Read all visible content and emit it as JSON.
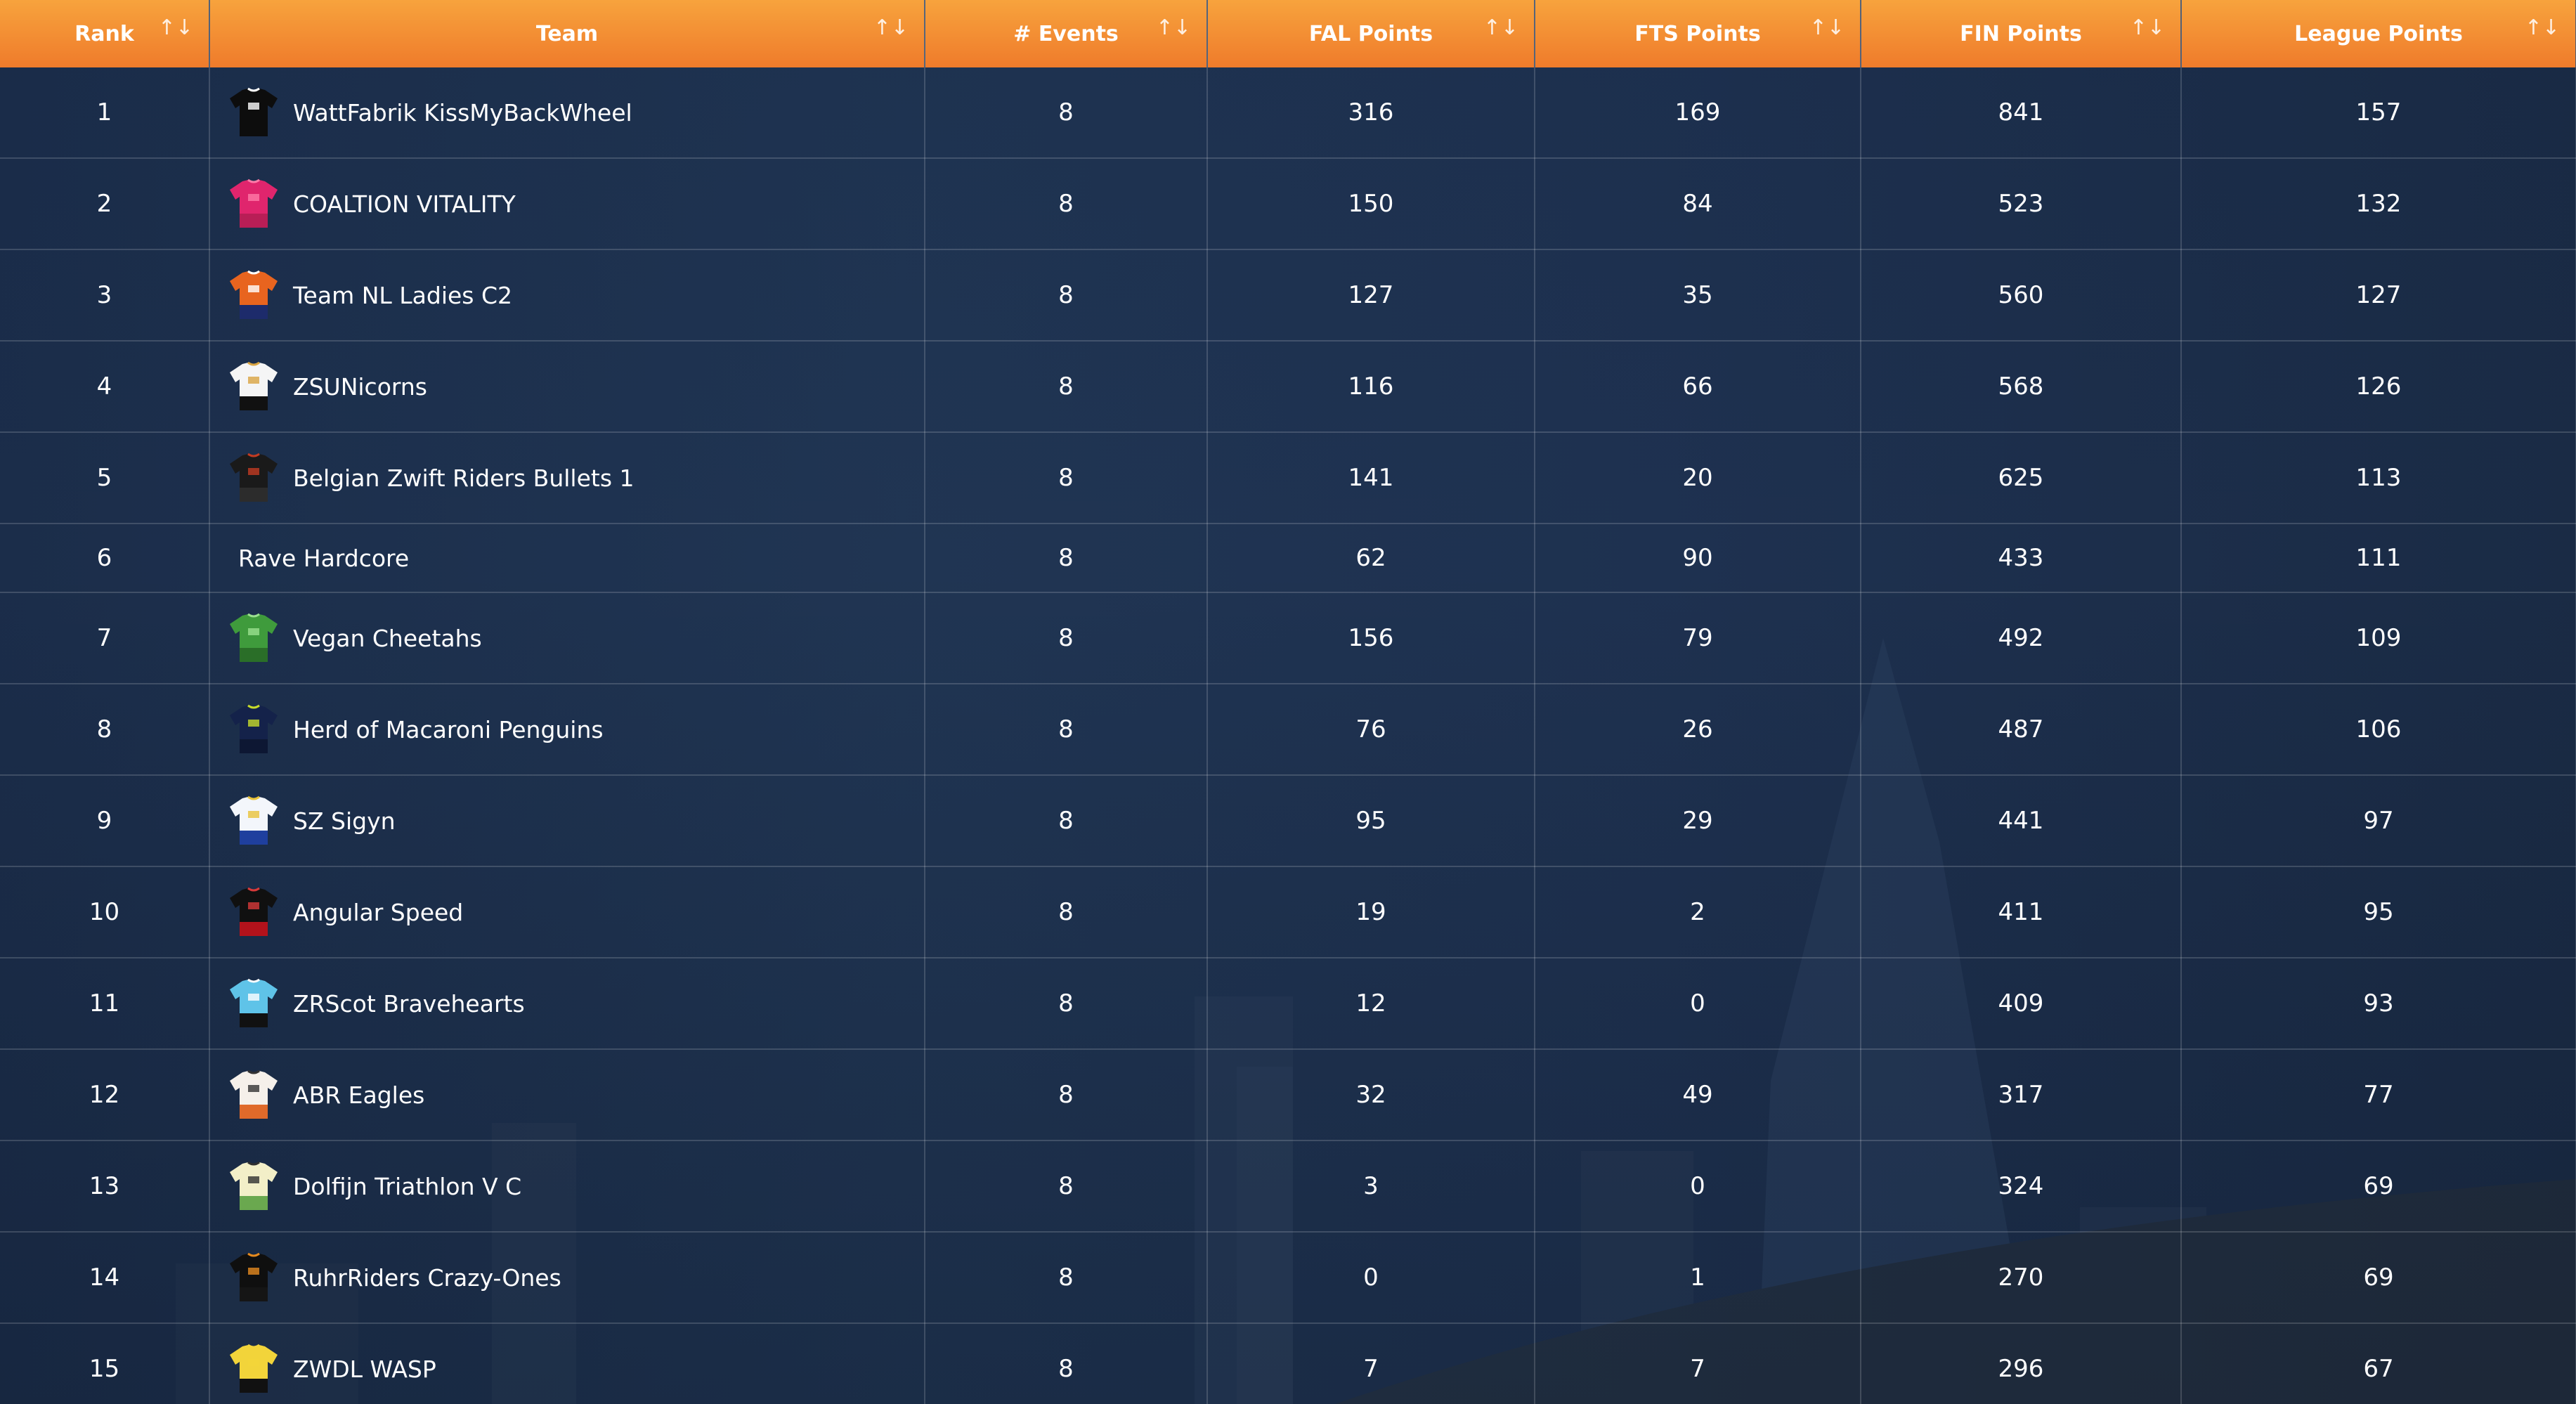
{
  "table": {
    "headers": {
      "rank": "Rank",
      "team": "Team",
      "events": "# Events",
      "fal": "FAL Points",
      "fts": "FTS Points",
      "fin": "FIN Points",
      "league": "League Points"
    },
    "sort_icon": "↑↓",
    "rows": [
      {
        "rank": "1",
        "team": "WattFabrik KissMyBackWheel",
        "events": "8",
        "fal": "316",
        "fts": "169",
        "fin": "841",
        "league": "157",
        "jersey": "black"
      },
      {
        "rank": "2",
        "team": "COALTION VITALITY",
        "events": "8",
        "fal": "150",
        "fts": "84",
        "fin": "523",
        "league": "132",
        "jersey": "pink"
      },
      {
        "rank": "3",
        "team": "Team NL Ladies C2",
        "events": "8",
        "fal": "127",
        "fts": "35",
        "fin": "560",
        "league": "127",
        "jersey": "orange-navy"
      },
      {
        "rank": "4",
        "team": "ZSUNicorns",
        "events": "8",
        "fal": "116",
        "fts": "66",
        "fin": "568",
        "league": "126",
        "jersey": "white-black"
      },
      {
        "rank": "5",
        "team": "Belgian Zwift Riders Bullets 1",
        "events": "8",
        "fal": "141",
        "fts": "20",
        "fin": "625",
        "league": "113",
        "jersey": "dark"
      },
      {
        "rank": "6",
        "team": "Rave Hardcore",
        "events": "8",
        "fal": "62",
        "fts": "90",
        "fin": "433",
        "league": "111",
        "jersey": ""
      },
      {
        "rank": "7",
        "team": "Vegan Cheetahs",
        "events": "8",
        "fal": "156",
        "fts": "79",
        "fin": "492",
        "league": "109",
        "jersey": "green"
      },
      {
        "rank": "8",
        "team": "Herd of Macaroni Penguins",
        "events": "8",
        "fal": "76",
        "fts": "26",
        "fin": "487",
        "league": "106",
        "jersey": "navy"
      },
      {
        "rank": "9",
        "team": "SZ Sigyn",
        "events": "8",
        "fal": "95",
        "fts": "29",
        "fin": "441",
        "league": "97",
        "jersey": "white-blue"
      },
      {
        "rank": "10",
        "team": "Angular Speed",
        "events": "8",
        "fal": "19",
        "fts": "2",
        "fin": "411",
        "league": "95",
        "jersey": "black-red"
      },
      {
        "rank": "11",
        "team": "ZRScot Bravehearts",
        "events": "8",
        "fal": "12",
        "fts": "0",
        "fin": "409",
        "league": "93",
        "jersey": "lightblue-black"
      },
      {
        "rank": "12",
        "team": "ABR Eagles",
        "events": "8",
        "fal": "32",
        "fts": "49",
        "fin": "317",
        "league": "77",
        "jersey": "white-orange"
      },
      {
        "rank": "13",
        "team": "Dolfijn Triathlon V C",
        "events": "8",
        "fal": "3",
        "fts": "0",
        "fin": "324",
        "league": "69",
        "jersey": "cream"
      },
      {
        "rank": "14",
        "team": "RuhrRiders Crazy-Ones",
        "events": "8",
        "fal": "0",
        "fts": "1",
        "fin": "270",
        "league": "69",
        "jersey": "black-orange"
      },
      {
        "rank": "15",
        "team": "ZWDL WASP",
        "events": "8",
        "fal": "7",
        "fts": "7",
        "fin": "296",
        "league": "67",
        "jersey": "yellow-black"
      }
    ]
  },
  "colors": {
    "header_top": "#f7a33d",
    "header_bottom": "#ef7b2b",
    "background": "#1c2e4a",
    "text": "#ffffff"
  }
}
